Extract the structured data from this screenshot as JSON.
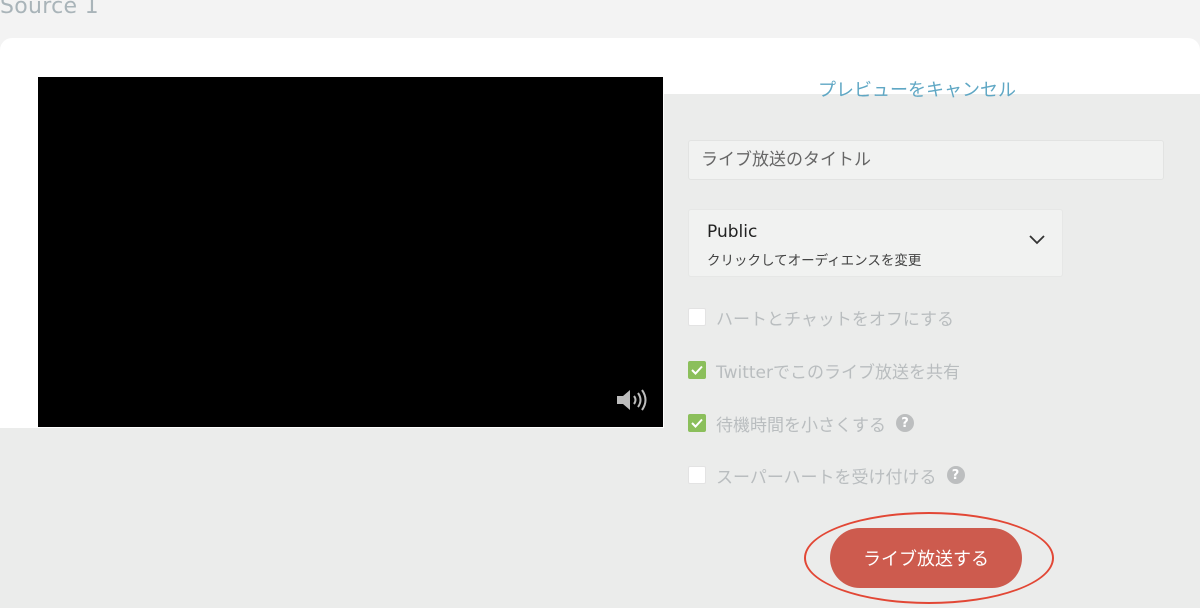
{
  "source": {
    "label": "Source 1"
  },
  "preview": {
    "cancel_label": "プレビューをキャンセル",
    "volume_icon": "speaker-icon"
  },
  "form": {
    "title_placeholder": "ライブ放送のタイトル",
    "audience": {
      "value": "Public",
      "hint": "クリックしてオーディエンスを変更",
      "icon": "chevron-down-icon"
    },
    "options": [
      {
        "label": "ハートとチャットをオフにする",
        "checked": false,
        "help": false
      },
      {
        "label": "Twitterでこのライブ放送を共有",
        "checked": true,
        "help": false
      },
      {
        "label": "待機時間を小さくする",
        "checked": true,
        "help": true
      },
      {
        "label": "スーパーハートを受け付ける",
        "checked": false,
        "help": true
      }
    ],
    "help_glyph": "?",
    "submit_label": "ライブ放送する"
  },
  "colors": {
    "accent_link": "#5fa7c4",
    "checkbox_checked": "#8bbf5b",
    "go_live_button": "#cd5b4e",
    "highlight_ring": "#e24735"
  }
}
